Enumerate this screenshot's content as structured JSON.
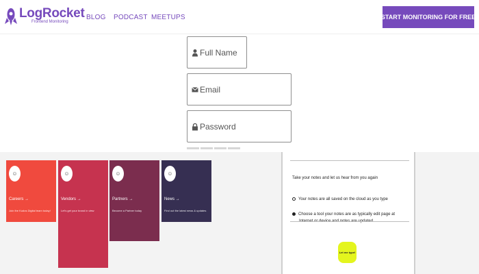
{
  "header": {
    "logo_text": "LogRocket",
    "logo_subtitle": "Frontend Monitoring",
    "nav": [
      "BLOG",
      "PODCAST",
      "MEETUPS"
    ],
    "cta_label": "START MONITORING FOR FREE",
    "accent_color": "#764abc"
  },
  "signup_form": {
    "full_name_placeholder": "Full Name",
    "email_placeholder": "Email",
    "password_placeholder": "Password",
    "icons": [
      "user-icon",
      "envelope-icon",
      "lock-icon"
    ]
  },
  "cards": [
    {
      "title": "Careers →",
      "description": "Join the Kudos Digital team today!",
      "color": "#f04a3e"
    },
    {
      "title": "Vendors →",
      "description": "Let's get your brand in view",
      "color": "#c6334f"
    },
    {
      "title": "Partners →",
      "description": "Become a Partner today",
      "color": "#7b2d4e"
    },
    {
      "title": "News →",
      "description": "Find out the latest news & updates",
      "color": "#362f52"
    }
  ],
  "survey": {
    "title": "Take your notes and let us hear from you again",
    "option_1": "Your notes are all saved on the cloud as you type",
    "option_2_line1": "Choose a tool your notes are as typically edit page at",
    "option_2_line2": "Internet or device and notes are updated",
    "button_label": "Let me type!",
    "button_color": "#e4f51e"
  }
}
